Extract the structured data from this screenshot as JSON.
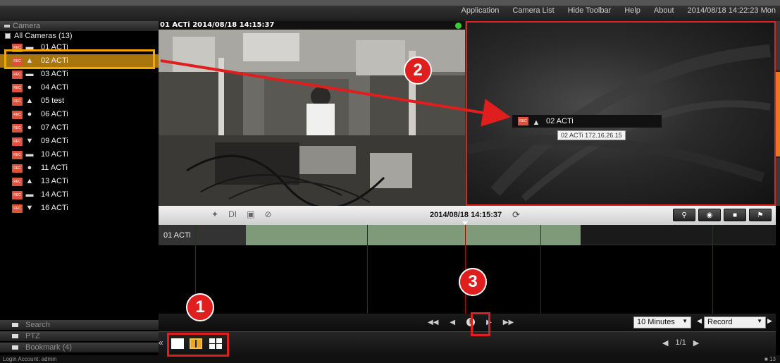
{
  "menu": {
    "items": [
      "Application",
      "Camera List",
      "Hide Toolbar",
      "Help",
      "About"
    ],
    "datetime": "2014/08/18 14:22:23 Mon"
  },
  "sidebar": {
    "camera_header": "Camera",
    "root_label": "All Cameras (13)",
    "cameras": [
      {
        "label": "01  ACTi",
        "icon": "box-camera-icon",
        "selected": false
      },
      {
        "label": "02  ACTi",
        "icon": "ptz-camera-icon",
        "selected": true
      },
      {
        "label": "03  ACTi",
        "icon": "box-camera-icon",
        "selected": false
      },
      {
        "label": "04  ACTi",
        "icon": "dome-camera-icon",
        "selected": false
      },
      {
        "label": "05  test",
        "icon": "ptz-camera-icon",
        "selected": false
      },
      {
        "label": "06  ACTi",
        "icon": "dome-camera-icon",
        "selected": false
      },
      {
        "label": "07  ACTi",
        "icon": "dome-camera-icon",
        "selected": false
      },
      {
        "label": "09  ACTi",
        "icon": "bullet-camera-icon",
        "selected": false
      },
      {
        "label": "10  ACTi",
        "icon": "box-camera-icon",
        "selected": false
      },
      {
        "label": "11  ACTi",
        "icon": "dome-camera-icon",
        "selected": false
      },
      {
        "label": "13  ACTi",
        "icon": "ptz-camera-icon",
        "selected": false
      },
      {
        "label": "14  ACTi",
        "icon": "box-camera-icon",
        "selected": false
      },
      {
        "label": "16  ACTi",
        "icon": "bullet-camera-icon",
        "selected": false
      }
    ],
    "rec_badge": "REC",
    "search_label": "Search",
    "ptz_label": "PTZ",
    "bookmark_label": "Bookmark (4)"
  },
  "video1": {
    "title": "01 ACTi   2014/08/18 14:15:37",
    "status_color": "#33cc33"
  },
  "video2": {
    "drag_label": "02  ACTi",
    "tooltip": "02 ACTi 172.16.26.15"
  },
  "timeline": {
    "toolbar_icons": [
      "motion-icon",
      "di-icon",
      "alarm-icon",
      "tamper-icon"
    ],
    "di_label": "DI",
    "current_time": "2014/08/18 14:15:37",
    "row_label": "01 ACTi",
    "record_color": "#7e9a78"
  },
  "controls": {
    "zoom_value": "10 Minutes",
    "mode_value": "Record"
  },
  "layout": {
    "page": "1/1",
    "options": [
      "single-layout-icon",
      "dual-layout-icon",
      "quad-layout-icon"
    ],
    "selected_index": 1
  },
  "status": {
    "login": "Login Account: admin",
    "count": "13"
  },
  "annotations": {
    "one": "1",
    "two": "2",
    "three": "3"
  }
}
